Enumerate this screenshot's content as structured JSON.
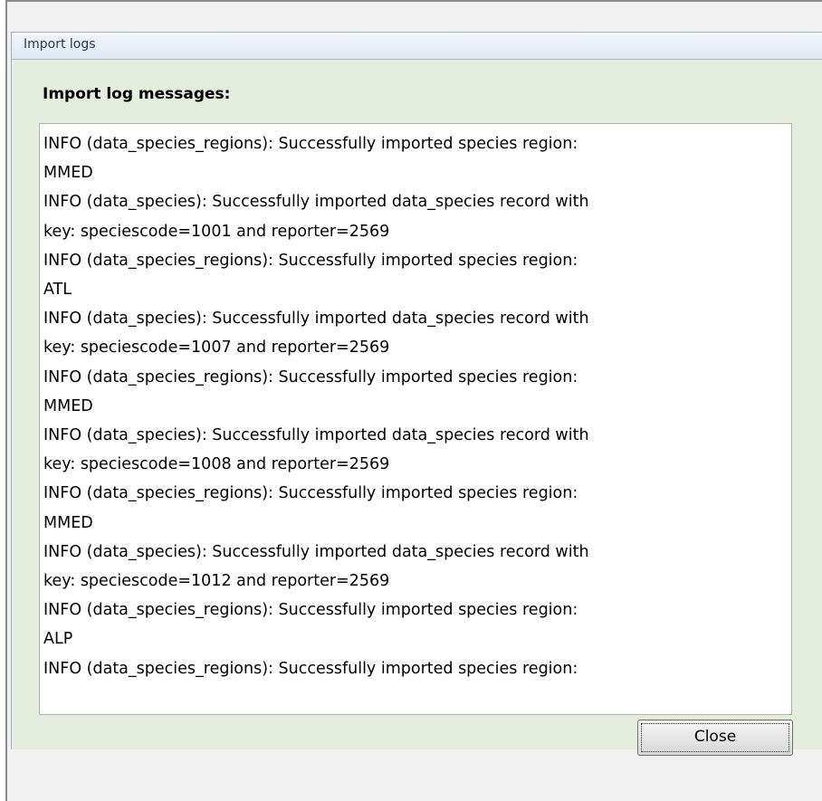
{
  "dialog": {
    "title": "Import logs",
    "heading": "Import log messages:",
    "log_lines": [
      "INFO (data_species_regions): Successfully imported species region:",
      "MMED",
      "INFO (data_species): Successfully imported data_species record with",
      "key:  speciescode=1001 and reporter=2569",
      "INFO (data_species_regions): Successfully imported species region:",
      "ATL",
      "INFO (data_species): Successfully imported data_species record with",
      "key:  speciescode=1007 and reporter=2569",
      "INFO (data_species_regions): Successfully imported species region:",
      "MMED",
      "INFO (data_species): Successfully imported data_species record with",
      "key:  speciescode=1008 and reporter=2569",
      "INFO (data_species_regions): Successfully imported species region:",
      "MMED",
      "INFO (data_species): Successfully imported data_species record with",
      "key:  speciescode=1012 and reporter=2569",
      "INFO (data_species_regions): Successfully imported species region:",
      "ALP",
      "INFO (data_species_regions): Successfully imported species region:"
    ],
    "close_label": "Close"
  },
  "colors": {
    "dialog_background": "#e5eddc",
    "title_bar": "#dfe8f3",
    "title_text": "#1e395b",
    "log_background": "#ffffff"
  }
}
